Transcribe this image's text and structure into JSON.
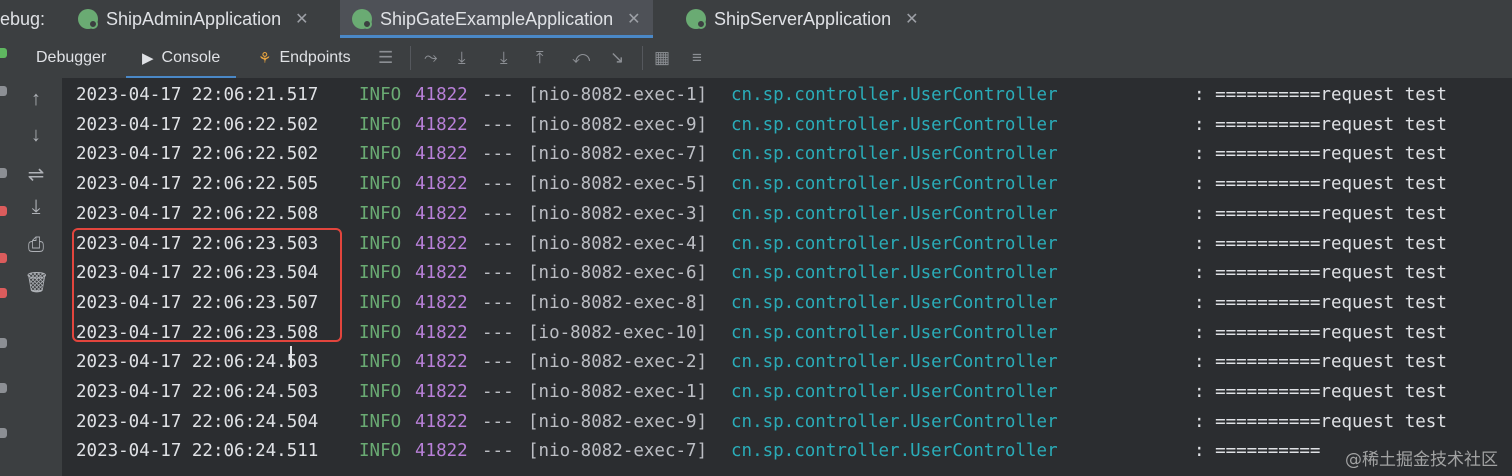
{
  "debug_label": "ebug:",
  "run_tabs": [
    {
      "label": "ShipAdminApplication",
      "active": false
    },
    {
      "label": "ShipGateExampleApplication",
      "active": true
    },
    {
      "label": "ShipServerApplication",
      "active": false
    }
  ],
  "tool_tabs": {
    "debugger": "Debugger",
    "console": "Console",
    "endpoints": "Endpoints"
  },
  "logs": [
    {
      "ts": "2023-04-17 22:06:21.517",
      "level": "INFO",
      "pid": "41822",
      "sep": "---",
      "thread": "[nio-8082-exec-1]",
      "logger": "cn.sp.controller.UserController",
      "msg": ": ==========request test"
    },
    {
      "ts": "2023-04-17 22:06:22.502",
      "level": "INFO",
      "pid": "41822",
      "sep": "---",
      "thread": "[nio-8082-exec-9]",
      "logger": "cn.sp.controller.UserController",
      "msg": ": ==========request test"
    },
    {
      "ts": "2023-04-17 22:06:22.502",
      "level": "INFO",
      "pid": "41822",
      "sep": "---",
      "thread": "[nio-8082-exec-7]",
      "logger": "cn.sp.controller.UserController",
      "msg": ": ==========request test"
    },
    {
      "ts": "2023-04-17 22:06:22.505",
      "level": "INFO",
      "pid": "41822",
      "sep": "---",
      "thread": "[nio-8082-exec-5]",
      "logger": "cn.sp.controller.UserController",
      "msg": ": ==========request test"
    },
    {
      "ts": "2023-04-17 22:06:22.508",
      "level": "INFO",
      "pid": "41822",
      "sep": "---",
      "thread": "[nio-8082-exec-3]",
      "logger": "cn.sp.controller.UserController",
      "msg": ": ==========request test"
    },
    {
      "ts": "2023-04-17 22:06:23.503",
      "level": "INFO",
      "pid": "41822",
      "sep": "---",
      "thread": "[nio-8082-exec-4]",
      "logger": "cn.sp.controller.UserController",
      "msg": ": ==========request test"
    },
    {
      "ts": "2023-04-17 22:06:23.504",
      "level": "INFO",
      "pid": "41822",
      "sep": "---",
      "thread": "[nio-8082-exec-6]",
      "logger": "cn.sp.controller.UserController",
      "msg": ": ==========request test"
    },
    {
      "ts": "2023-04-17 22:06:23.507",
      "level": "INFO",
      "pid": "41822",
      "sep": "---",
      "thread": "[nio-8082-exec-8]",
      "logger": "cn.sp.controller.UserController",
      "msg": ": ==========request test"
    },
    {
      "ts": "2023-04-17 22:06:23.508",
      "level": "INFO",
      "pid": "41822",
      "sep": "---",
      "thread": "[io-8082-exec-10]",
      "logger": "cn.sp.controller.UserController",
      "msg": ": ==========request test"
    },
    {
      "ts": "2023-04-17 22:06:24.503",
      "level": "INFO",
      "pid": "41822",
      "sep": "---",
      "thread": "[nio-8082-exec-2]",
      "logger": "cn.sp.controller.UserController",
      "msg": ": ==========request test"
    },
    {
      "ts": "2023-04-17 22:06:24.503",
      "level": "INFO",
      "pid": "41822",
      "sep": "---",
      "thread": "[nio-8082-exec-1]",
      "logger": "cn.sp.controller.UserController",
      "msg": ": ==========request test"
    },
    {
      "ts": "2023-04-17 22:06:24.504",
      "level": "INFO",
      "pid": "41822",
      "sep": "---",
      "thread": "[nio-8082-exec-9]",
      "logger": "cn.sp.controller.UserController",
      "msg": ": ==========request test"
    },
    {
      "ts": "2023-04-17 22:06:24.511",
      "level": "INFO",
      "pid": "41822",
      "sep": "---",
      "thread": "[nio-8082-exec-7]",
      "logger": "cn.sp.controller.UserController",
      "msg": ": =========="
    }
  ],
  "watermark": "@稀土掘金技术社区",
  "colors": {
    "accent": "#4a88c7",
    "highlight": "#e2453d",
    "level": "#6aab73",
    "pid": "#b880d8",
    "logger": "#2aacb8"
  }
}
